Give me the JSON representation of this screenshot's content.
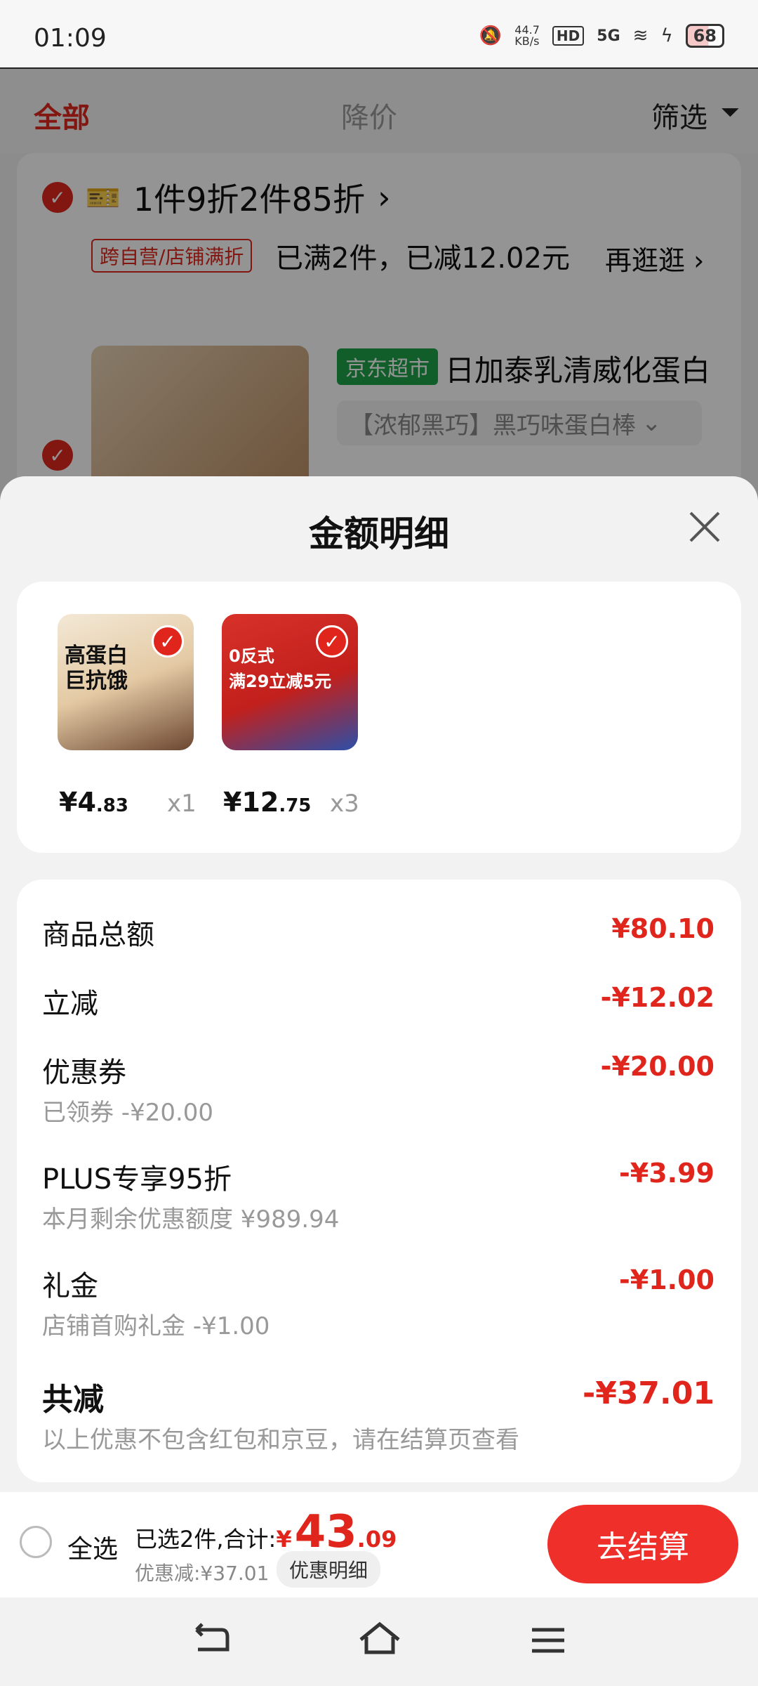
{
  "status_bar": {
    "time": "01:09",
    "net_speed": "44.7\nKB/s",
    "network": "5G",
    "hd": "HD",
    "battery": "68"
  },
  "tabs": {
    "all": "全部",
    "price_drop": "降价",
    "filter": "筛选"
  },
  "cart": {
    "promo": "1件9折2件85折",
    "promo_chevron": "›",
    "promo_badge": "跨自营/店铺满折",
    "promo_status": "已满2件，已减12.02元",
    "go_more": "再逛逛 ›",
    "product_badge": "京东超市",
    "product_title": "日加泰乳清威化蛋白",
    "product_spec": "【浓郁黑巧】黑巧味蛋白棒"
  },
  "sheet": {
    "title": "金额明细",
    "items": [
      {
        "price_int": "¥4",
        "price_dec": ".83",
        "qty": "x1",
        "thumb_text": "高蛋白\n巨抗饿"
      },
      {
        "price_int": "¥12",
        "price_dec": ".75",
        "qty": "x3",
        "thumb_text": "0反式\n满29立减5元"
      }
    ],
    "rows": {
      "goods_total": {
        "label": "商品总额",
        "value": "¥80.10"
      },
      "instant_off": {
        "label": "立减",
        "value": "-¥12.02"
      },
      "coupon": {
        "label": "优惠券",
        "sub": "已领券 -¥20.00",
        "value": "-¥20.00"
      },
      "plus": {
        "label": "PLUS专享95折",
        "sub": "本月剩余优惠额度 ¥989.94",
        "value": "-¥3.99"
      },
      "gift": {
        "label": "礼金",
        "sub": "店铺首购礼金 -¥1.00",
        "value": "-¥1.00"
      },
      "total": {
        "label": "共减",
        "sub": "以上优惠不包含红包和京豆，请在结算页查看",
        "value": "-¥37.01"
      }
    }
  },
  "bottom": {
    "select_all": "全选",
    "selected_text": "已选2件,合计:",
    "currency": "¥",
    "amount_int": "43",
    "amount_dec": ".09",
    "discount": "优惠减:¥37.01",
    "detail_chip": "优惠明细",
    "checkout": "去结算"
  },
  "icons": [
    "back-icon",
    "home-icon",
    "menu-icon",
    "close-icon",
    "check-icon",
    "filter-icon",
    "coupon-icon"
  ],
  "colors": {
    "accent": "#e0261c",
    "checkout": "#ef2f2a",
    "jd_green": "#1ea34b"
  }
}
